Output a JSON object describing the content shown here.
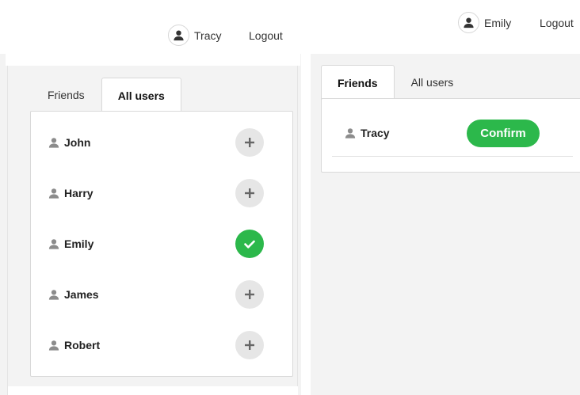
{
  "left": {
    "user": {
      "name": "Tracy",
      "icon": "user-avatar-icon"
    },
    "logout_label": "Logout",
    "tabs": [
      {
        "label": "Friends",
        "active": false
      },
      {
        "label": "All users",
        "active": true
      }
    ],
    "users": [
      {
        "name": "John",
        "status": "add"
      },
      {
        "name": "Harry",
        "status": "add"
      },
      {
        "name": "Emily",
        "status": "friend"
      },
      {
        "name": "James",
        "status": "add"
      },
      {
        "name": "Robert",
        "status": "add"
      }
    ]
  },
  "right": {
    "user": {
      "name": "Emily",
      "icon": "user-avatar-icon"
    },
    "logout_label": "Logout",
    "tabs": [
      {
        "label": "Friends",
        "active": true
      },
      {
        "label": "All users",
        "active": false
      }
    ],
    "requests": [
      {
        "name": "Tracy",
        "action_label": "Confirm"
      }
    ]
  },
  "colors": {
    "accent_green": "#2cb84b",
    "add_gray": "#e6e6e6",
    "page_bg": "#f3f3f3"
  }
}
